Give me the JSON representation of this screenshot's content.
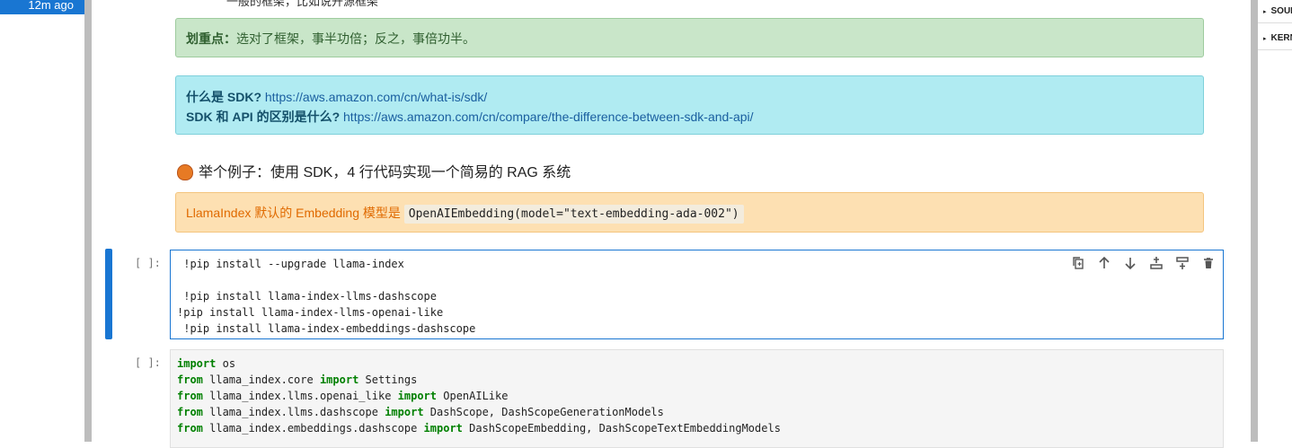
{
  "status": {
    "time": "12m ago"
  },
  "side_panel": {
    "items": [
      "SOURCE",
      "KERNEL"
    ]
  },
  "top_cut_text": "一般的框架，比如说开源框架",
  "tip": {
    "label": "划重点：",
    "text": "选对了框架，事半功倍；反之，事倍功半。"
  },
  "links": [
    {
      "label": "什么是 SDK?",
      "url": "https://aws.amazon.com/cn/what-is/sdk/"
    },
    {
      "label": "SDK 和 API 的区别是什么?",
      "url": "https://aws.amazon.com/cn/compare/the-difference-between-sdk-and-api/"
    }
  ],
  "heading": {
    "icon": "chestnut-icon",
    "text": "举个例子：使用 SDK，4 行代码实现一个简易的 RAG 系统"
  },
  "warning": {
    "text": "LlamaIndex 默认的 Embedding 模型是",
    "code": "OpenAIEmbedding(model=\"text-embedding-ada-002\")"
  },
  "cells": [
    {
      "prompt": "[ ]:",
      "lines": [
        " !pip install --upgrade llama-index",
        "",
        " !pip install llama-index-llms-dashscope",
        "!pip install llama-index-llms-openai-like",
        " !pip install llama-index-embeddings-dashscope"
      ]
    },
    {
      "prompt": "[ ]:",
      "lines": [
        "import os",
        "from llama_index.core import Settings",
        "from llama_index.llms.openai_like import OpenAILike",
        "from llama_index.llms.dashscope import DashScope, DashScopeGenerationModels",
        "from llama_index.embeddings.dashscope import DashScopeEmbedding, DashScopeTextEmbeddingModels"
      ]
    }
  ],
  "cell_toolbar": [
    "duplicate-icon",
    "move-up-icon",
    "move-down-icon",
    "insert-above-icon",
    "insert-below-icon",
    "delete-icon"
  ]
}
